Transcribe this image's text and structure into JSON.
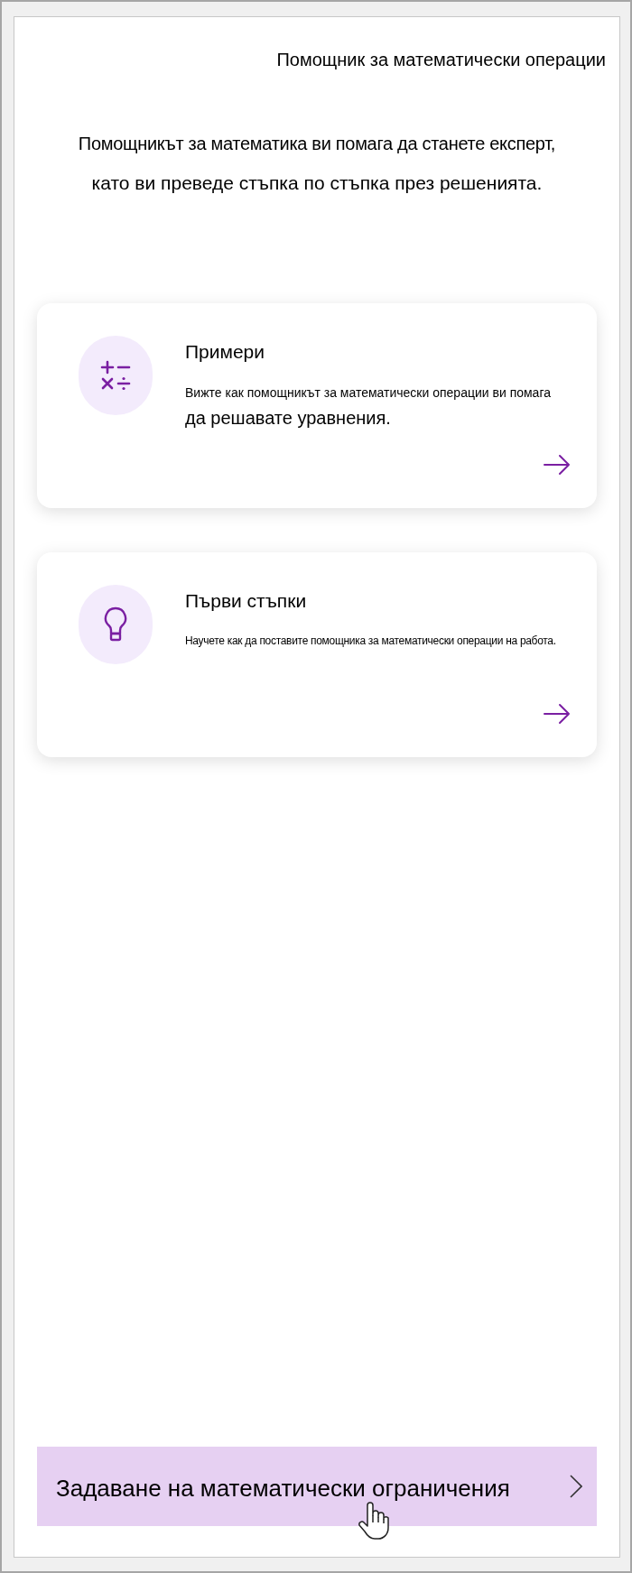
{
  "header": {
    "title": "Помощник за математически операции"
  },
  "intro": {
    "lines": [
      "Помощникът за математика ви помага да станете експерт,",
      "като ви преведе стъпка по стъпка през решенията."
    ]
  },
  "cards": [
    {
      "kind": "examples",
      "title": "Примери",
      "description_lines": [
        "Вижте как помощникът за математически операции ви помага",
        "да решавате уравнения."
      ]
    },
    {
      "kind": "start",
      "title": "Първи стъпки",
      "description_lines": [
        "Научете как да поставите помощника за математически операции на работа."
      ]
    }
  ],
  "constraints_button": {
    "label": "Задаване на математически ограничения"
  }
}
